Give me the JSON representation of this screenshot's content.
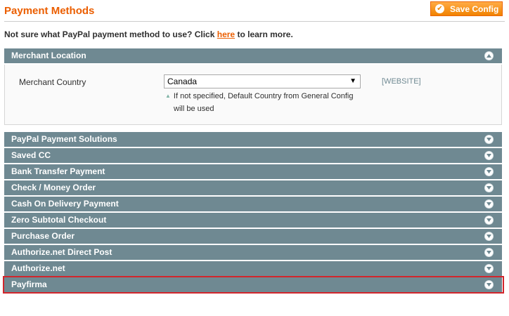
{
  "header": {
    "title": "Payment Methods",
    "save_label": "Save Config"
  },
  "notice": {
    "before": "Not sure what PayPal payment method to use? Click ",
    "link": "here",
    "after": " to learn more."
  },
  "merchant_location": {
    "title": "Merchant Location",
    "state": "expanded",
    "field_label": "Merchant Country",
    "selected_value": "Canada",
    "hint_line1": "If not specified, Default Country from General Config",
    "hint_line2": "will be used",
    "scope": "[WEBSITE]"
  },
  "sections": [
    {
      "title": "PayPal Payment Solutions"
    },
    {
      "title": "Saved CC"
    },
    {
      "title": "Bank Transfer Payment"
    },
    {
      "title": "Check / Money Order"
    },
    {
      "title": "Cash On Delivery Payment"
    },
    {
      "title": "Zero Subtotal Checkout"
    },
    {
      "title": "Purchase Order"
    },
    {
      "title": "Authorize.net Direct Post"
    },
    {
      "title": "Authorize.net"
    },
    {
      "title": "Payfirma",
      "highlighted": true
    }
  ],
  "colors": {
    "accent": "#eb5e00",
    "section_header": "#6f8992",
    "highlight_border": "#d2252c"
  },
  "icons": {
    "save": "checkmark-circle-icon",
    "expanded": "collapse-up-icon",
    "collapsed": "expand-down-icon"
  }
}
